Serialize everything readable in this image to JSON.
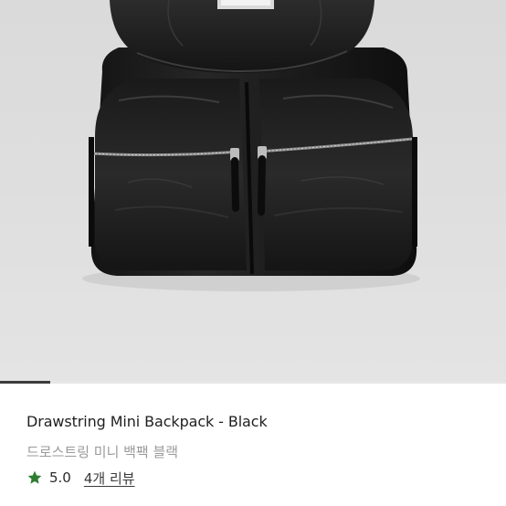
{
  "product": {
    "image_alt_subject": "black mini backpack",
    "title": "Drawstring Mini Backpack - Black",
    "subtitle": "드로스트링 미니 백팩 블랙",
    "rating": "5.0",
    "review_link_text": "4개 리뷰"
  },
  "carousel": {
    "progress": 0.1
  },
  "colors": {
    "star": "#2e7d32",
    "title": "#1f1f1f",
    "subtitle": "#9a9a9a",
    "image_background": "#dedede",
    "progress_fill": "#3c3c3c"
  },
  "icons": {
    "rating": "star-icon"
  }
}
